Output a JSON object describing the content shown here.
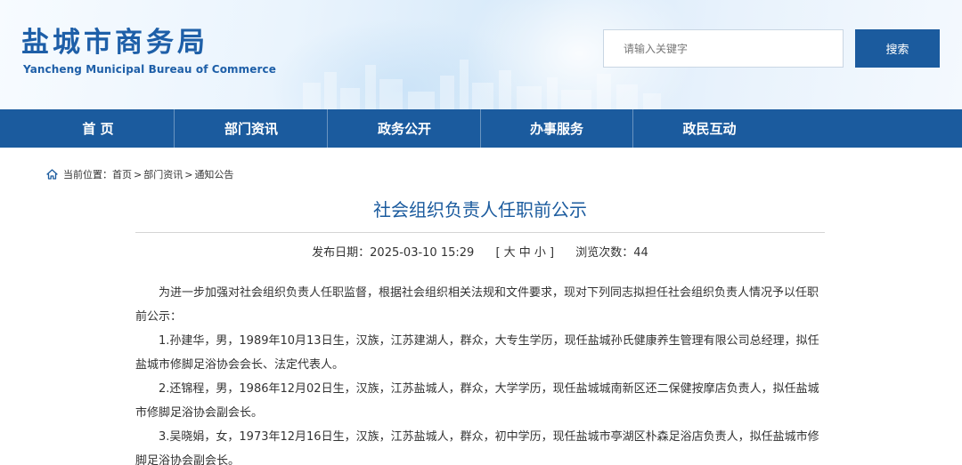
{
  "site": {
    "name_cn": "盐城市商务局",
    "name_en": "Yancheng Municipal Bureau of Commerce"
  },
  "search": {
    "placeholder": "请输入关键字",
    "button_label": "搜索"
  },
  "nav": {
    "items": [
      {
        "label": "首 页"
      },
      {
        "label": "部门资讯"
      },
      {
        "label": "政务公开"
      },
      {
        "label": "办事服务"
      },
      {
        "label": "政民互动"
      }
    ]
  },
  "breadcrumb": {
    "prefix": "当前位置：",
    "items": [
      "首页",
      "部门资讯",
      "通知公告"
    ],
    "separator": ">"
  },
  "article": {
    "title": "社会组织负责人任职前公示",
    "publish_date": "发布日期：2025-03-10 15:29",
    "font_size_control": "[ 大 中 小 ]",
    "view_count": "浏览次数：44",
    "paragraphs": [
      "为进一步加强对社会组织负责人任职监督，根据社会组织相关法规和文件要求，现对下列同志拟担任社会组织负责人情况予以任职前公示：",
      "1.孙建华，男，1989年10月13日生，汉族，江苏建湖人，群众，大专生学历，现任盐城孙氏健康养生管理有限公司总经理，拟任盐城市修脚足浴协会会长、法定代表人。",
      "2.还锦程，男，1986年12月02日生，汉族，江苏盐城人，群众，大学学历，现任盐城城南新区还二保健按摩店负责人，拟任盐城市修脚足浴协会副会长。",
      "3.吴晓娟，女，1973年12月16日生，汉族，江苏盐城人，群众，初中学历，现任盐城市亭湖区朴森足浴店负责人，拟任盐城市修脚足浴协会副会长。"
    ]
  },
  "colors": {
    "brand": "#1b5b9e",
    "logo": "#1e5fa8"
  }
}
